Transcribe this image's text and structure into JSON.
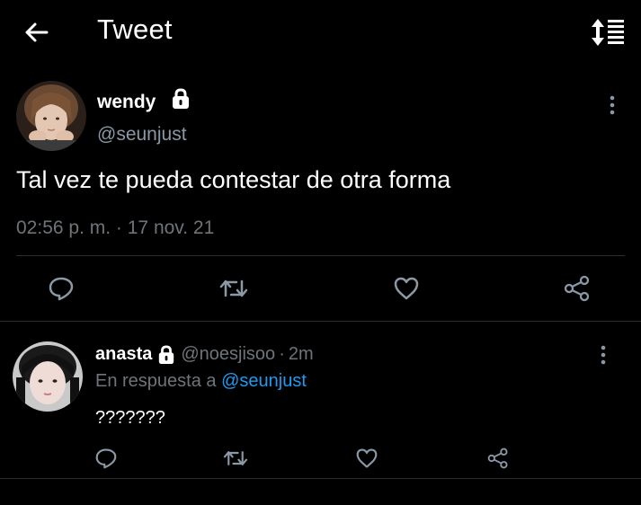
{
  "header": {
    "title": "Tweet",
    "back_icon": "arrow-left-icon",
    "sort_icon": "sort-icon"
  },
  "main_tweet": {
    "author_name": "wendy",
    "author_handle": "@seunjust",
    "protected": true,
    "text": "Tal vez te pueda contestar de otra forma",
    "time": "02:56 p. m.",
    "separator": "·",
    "date": "17 nov. 21",
    "actions": [
      "reply-icon",
      "retweet-icon",
      "like-icon",
      "share-icon"
    ]
  },
  "reply": {
    "author_name": "anasta",
    "author_handle": "@noesjisoo",
    "separator": "·",
    "time": "2m",
    "protected": true,
    "in_reply_prefix": "En respuesta a",
    "in_reply_to": "@seunjust",
    "text": "???????",
    "actions": [
      "reply-icon",
      "retweet-icon",
      "like-icon",
      "share-icon"
    ]
  },
  "colors": {
    "background": "#000000",
    "text_primary": "#ffffff",
    "text_secondary": "#6e7479",
    "accent": "#1d9bf0",
    "divider": "#2a2d31"
  }
}
